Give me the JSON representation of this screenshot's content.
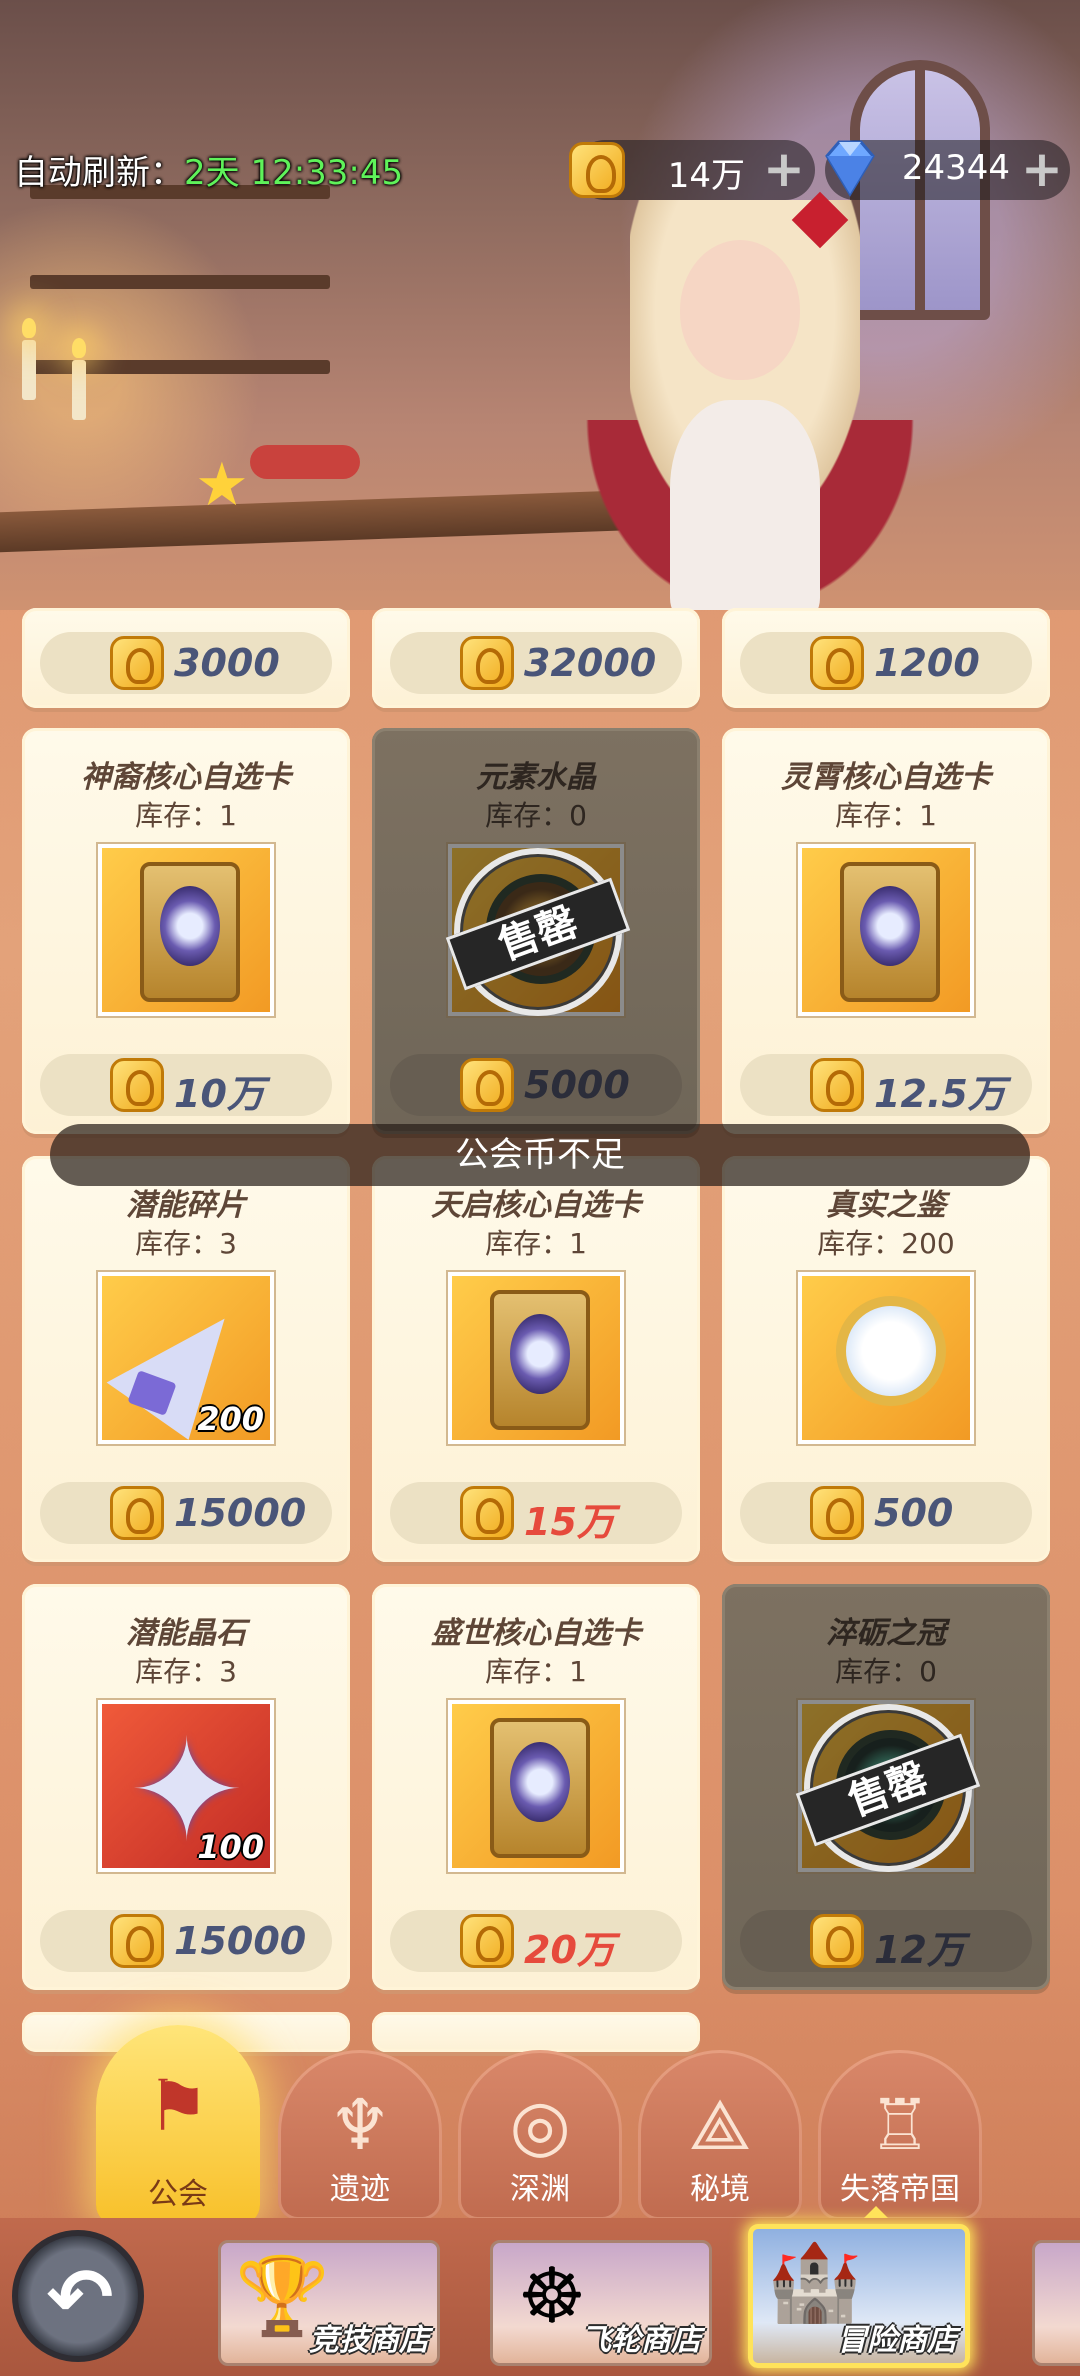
{
  "header": {
    "refresh_label": "自动刷新：",
    "refresh_time": "2天 12:33:45",
    "gold_amount": "14万",
    "gem_amount": "24344",
    "plus": "+"
  },
  "top_row_prices": [
    "3000",
    "32000",
    "1200"
  ],
  "items": [
    {
      "name": "神裔核心自选卡",
      "stock": "库存：1",
      "price": "10万",
      "sold_out": false
    },
    {
      "name": "元素水晶",
      "stock": "库存：0",
      "price": "5000",
      "sold_out": true,
      "sold_out_label": "售罄"
    },
    {
      "name": "灵霄核心自选卡",
      "stock": "库存：1",
      "price": "12.5万",
      "sold_out": false
    },
    {
      "name": "潜能碎片",
      "stock": "库存：3",
      "price": "15000",
      "qty": "200",
      "sold_out": false
    },
    {
      "name": "天启核心自选卡",
      "stock": "库存：1",
      "price": "15万",
      "price_red": true,
      "sold_out": false
    },
    {
      "name": "真实之鉴",
      "stock": "库存：200",
      "price": "500",
      "sold_out": false
    },
    {
      "name": "潜能晶石",
      "stock": "库存：3",
      "price": "15000",
      "qty": "100",
      "sold_out": false
    },
    {
      "name": "盛世核心自选卡",
      "stock": "库存：1",
      "price": "20万",
      "price_red": true,
      "sold_out": false
    },
    {
      "name": "淬砺之冠",
      "stock": "库存：0",
      "price": "12万",
      "sold_out": true,
      "sold_out_label": "售罄"
    }
  ],
  "toast": "公会币不足",
  "category_tabs": [
    {
      "label": "公会",
      "icon": "banner-icon",
      "active": true
    },
    {
      "label": "遗迹",
      "icon": "relic-icon",
      "active": false
    },
    {
      "label": "深渊",
      "icon": "abyss-icon",
      "active": false
    },
    {
      "label": "秘境",
      "icon": "secret-realm-icon",
      "active": false
    },
    {
      "label": "失落帝国",
      "icon": "lost-empire-icon",
      "active": false
    }
  ],
  "shop_tabs": [
    {
      "label": "竞技商店",
      "icon": "trophy-icon",
      "active": false
    },
    {
      "label": "飞轮商店",
      "icon": "wheel-icon",
      "active": false
    },
    {
      "label": "冒险商店",
      "icon": "castle-icon",
      "active": true
    }
  ],
  "colors": {
    "refresh_time": "#5ff25a",
    "price_normal": "#4a5578",
    "price_red": "#e64a3c",
    "active_tab": "#f8c02a"
  }
}
